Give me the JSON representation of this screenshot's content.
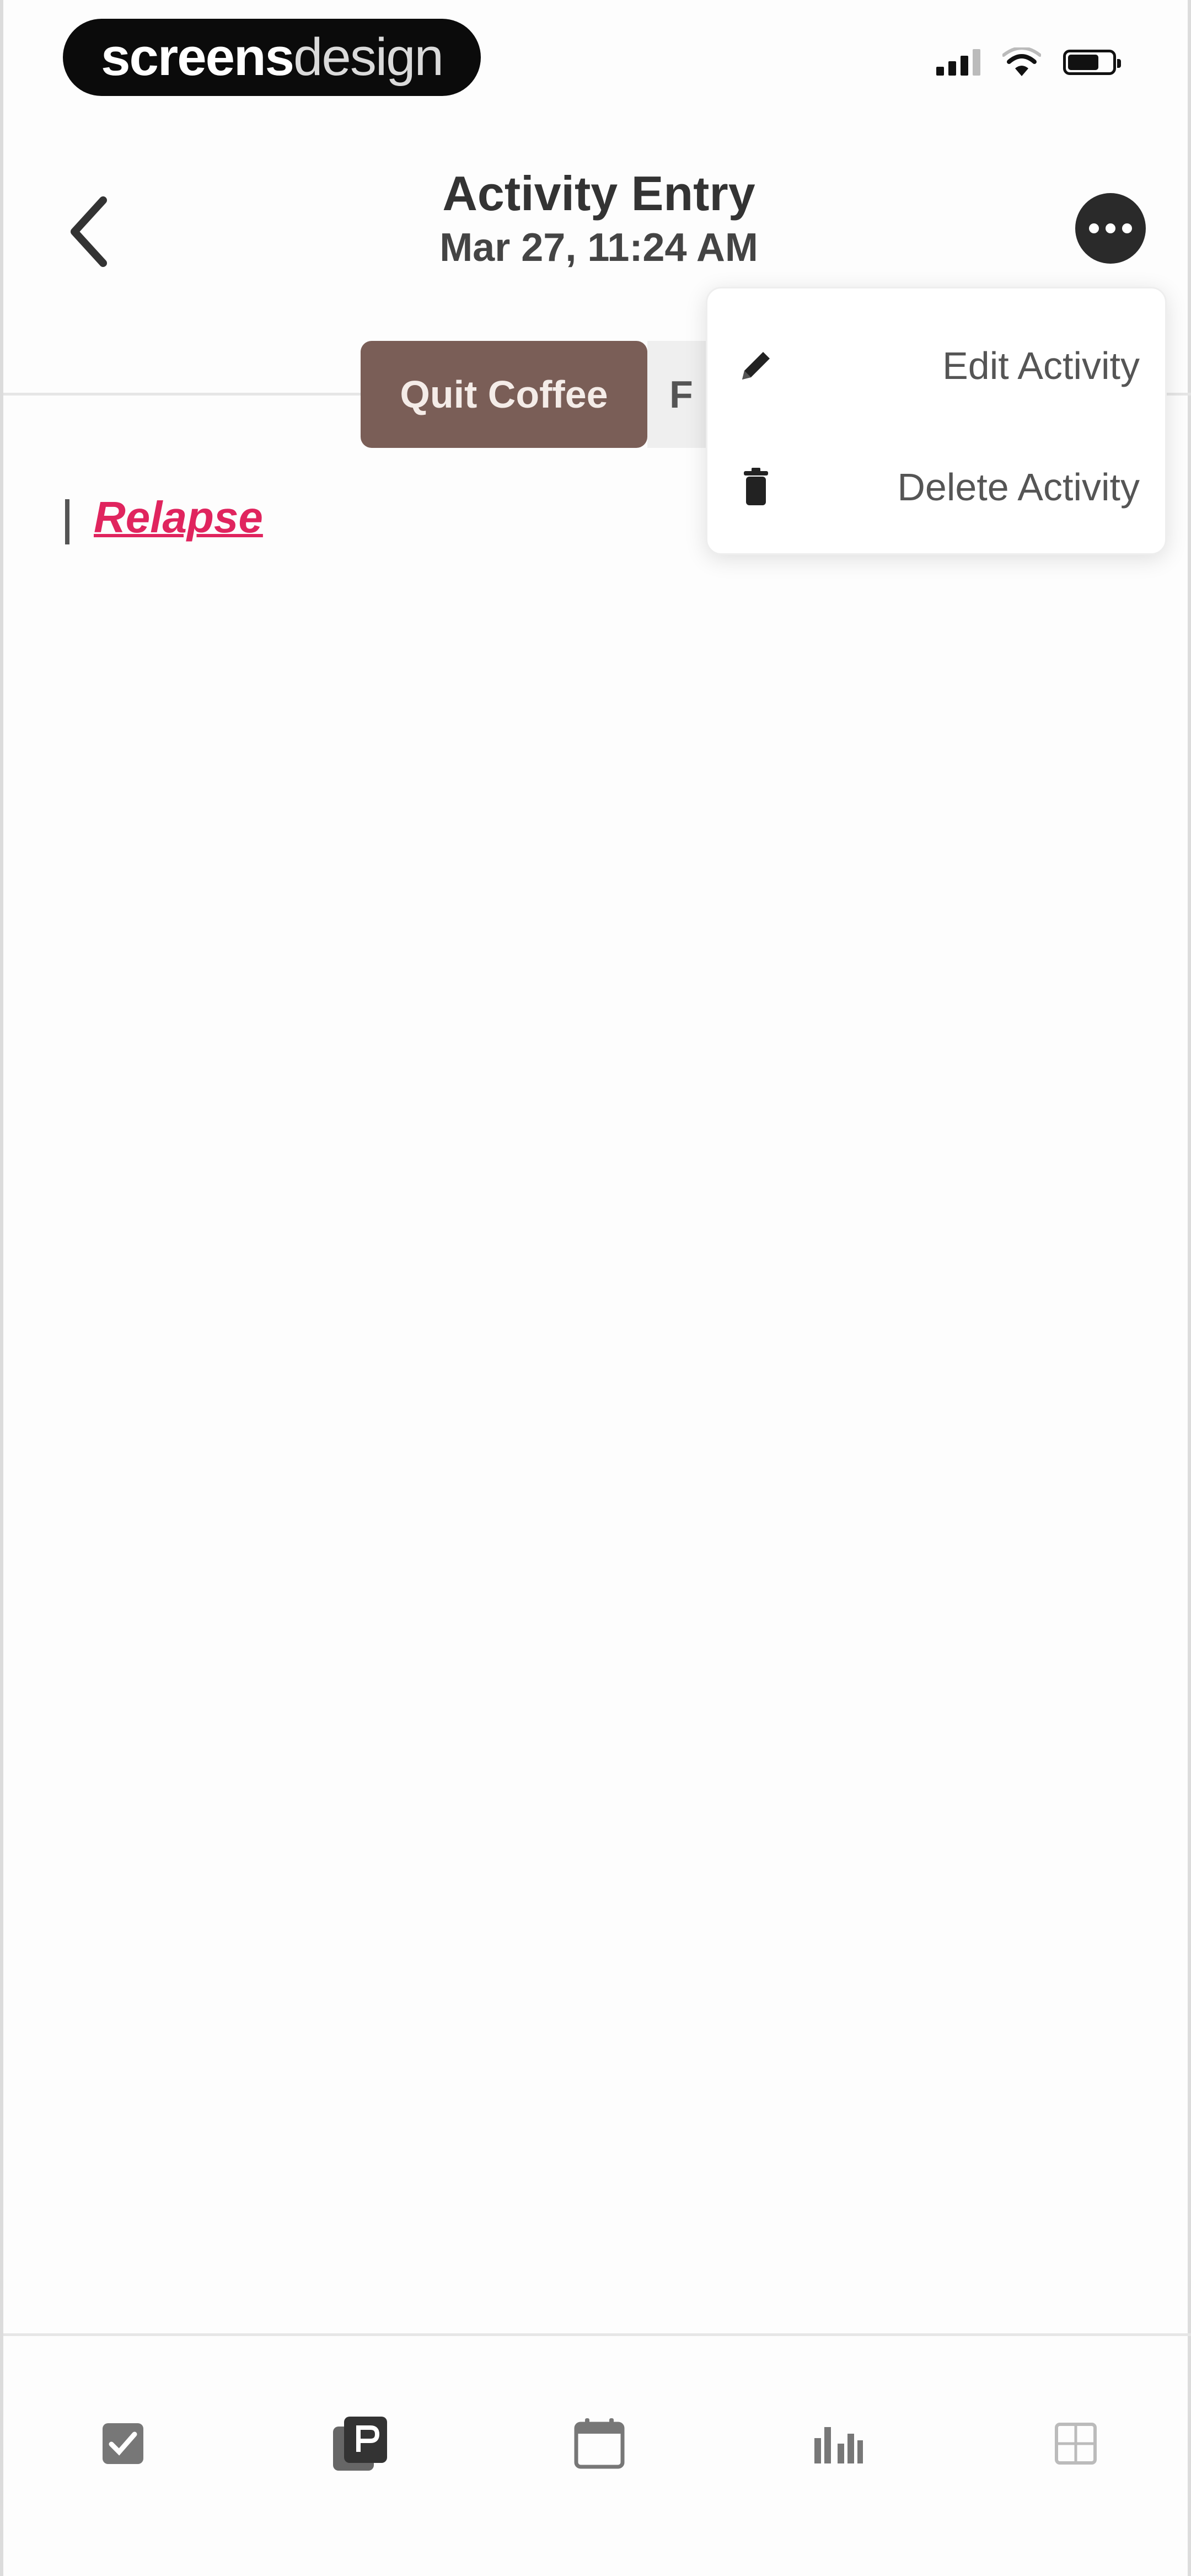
{
  "status_bar": {
    "brand_bold": "screens",
    "brand_light": "design",
    "signal_icon": "signal-icon",
    "wifi_icon": "wifi-icon",
    "battery_icon": "battery-icon"
  },
  "header": {
    "title": "Activity Entry",
    "subtitle": "Mar 27, 11:24 AM",
    "back_icon": "chevron-left-icon",
    "more_icon": "more-horizontal-icon"
  },
  "tags": [
    {
      "label": "Quit Coffee",
      "color": "#7a5e57"
    },
    {
      "label": "F",
      "color": "#efefef"
    }
  ],
  "entry": {
    "label": "Relapse",
    "color": "#e0245e"
  },
  "menu": {
    "items": [
      {
        "label": "Edit Activity",
        "icon": "pencil-icon"
      },
      {
        "label": "Delete Activity",
        "icon": "trash-icon"
      }
    ]
  },
  "tabbar": {
    "tabs": [
      {
        "icon": "checkbox-icon"
      },
      {
        "icon": "journal-icon"
      },
      {
        "icon": "calendar-icon"
      },
      {
        "icon": "stats-icon"
      },
      {
        "icon": "settings-grid-icon"
      }
    ]
  }
}
